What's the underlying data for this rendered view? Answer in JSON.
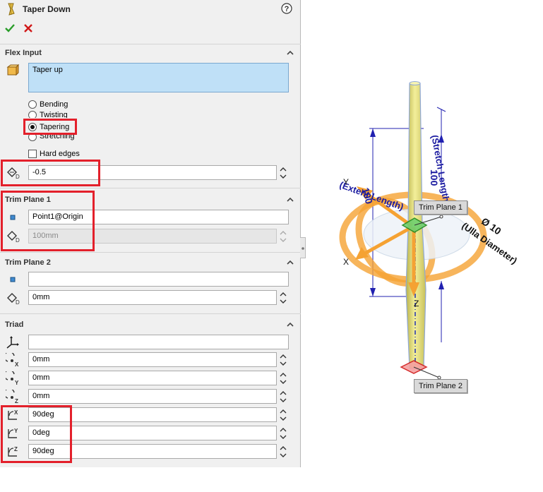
{
  "feature": {
    "title": "Taper Down"
  },
  "flex_input": {
    "header": "Flex Input",
    "selection": "Taper up",
    "options": [
      {
        "label": "Bending",
        "selected": false
      },
      {
        "label": "Twisting",
        "selected": false
      },
      {
        "label": "Tapering",
        "selected": true
      },
      {
        "label": "Stretching",
        "selected": false
      }
    ],
    "hard_edges_label": "Hard edges",
    "hard_edges_checked": false,
    "factor_value": "-0.5"
  },
  "trim_plane_1": {
    "header": "Trim Plane 1",
    "entity": "Point1@Origin",
    "offset": "100mm"
  },
  "trim_plane_2": {
    "header": "Trim Plane 2",
    "entity": "",
    "offset": "0mm"
  },
  "triad": {
    "header": "Triad",
    "entity": "",
    "x": "0mm",
    "y": "0mm",
    "z": "0mm",
    "rot_x": "90deg",
    "rot_y": "0deg",
    "rot_z": "90deg"
  },
  "viewport": {
    "callout_1": "Trim Plane 1",
    "callout_2": "Trim Plane 2",
    "dim_length": "100",
    "dim_length_note": "(Stretch Length)",
    "dim_extent": "100",
    "dim_extent_note": "(Extent Length)",
    "dim_diameter": "Ø 10",
    "dim_diameter_note": "(Ulla Diameter)",
    "axis_x": "X",
    "axis_y": "Y",
    "axis_z": "Z"
  },
  "colors": {
    "highlight_red": "#e3202b",
    "selection_blue": "#bfe0f7",
    "taper_yellow": "#e9e27a",
    "triad_orange": "#f5a233"
  }
}
